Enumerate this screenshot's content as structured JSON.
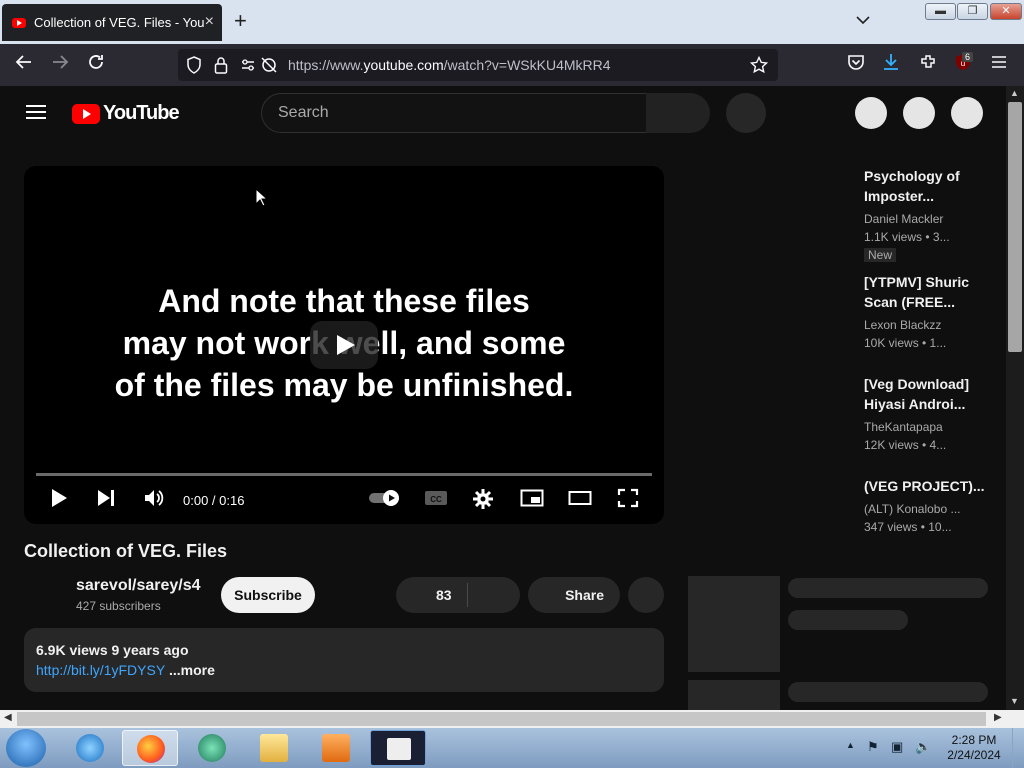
{
  "browser": {
    "tab_title": "Collection of VEG. Files - YouTube",
    "new_tab": "+",
    "url_prefix": "https://www.",
    "url_domain": "youtube.com",
    "url_path": "/watch?v=WSkKU4MkRR4",
    "extension_badge": "6"
  },
  "youtube": {
    "logo_text": "YouTube",
    "search_placeholder": "Search",
    "player": {
      "overlay_line1": "And note that these files",
      "overlay_line2": "may not work well, and some",
      "overlay_line3": "of the files may be unfinished.",
      "time": "0:00 / 0:16",
      "progress": 0
    },
    "video": {
      "title": "Collection of VEG. Files",
      "channel": "sarevol/sarey/s4",
      "subscribers": "427 subscribers",
      "subscribe_label": "Subscribe",
      "likes": "83",
      "share_label": "Share",
      "views_date": "6.9K views  9 years ago",
      "link": "http://bit.ly/1yFDYSY",
      "more": "...more"
    },
    "recommendations": [
      {
        "title": "Psychology of Imposter...",
        "channel": "Daniel Mackler",
        "meta": "1.1K views  • 3...",
        "badge": "New"
      },
      {
        "title": "[YTPMV] Shuric Scan (FREE...",
        "channel": "Lexon Blackzz",
        "meta": "10K views  • 1..."
      },
      {
        "title": "[Veg Download] Hiyasi Androi...",
        "channel": "TheKantapapa",
        "meta": "12K views  • 4..."
      },
      {
        "title": "(VEG PROJECT)...",
        "channel": "(ALT) Konalobo ...",
        "meta": "347 views  • 10..."
      }
    ]
  },
  "taskbar": {
    "time": "2:28 PM",
    "date": "2/24/2024"
  },
  "colors": {
    "youtube_red": "#ff0000",
    "link_blue": "#3ea6ff",
    "background": "#0f0f0f"
  }
}
